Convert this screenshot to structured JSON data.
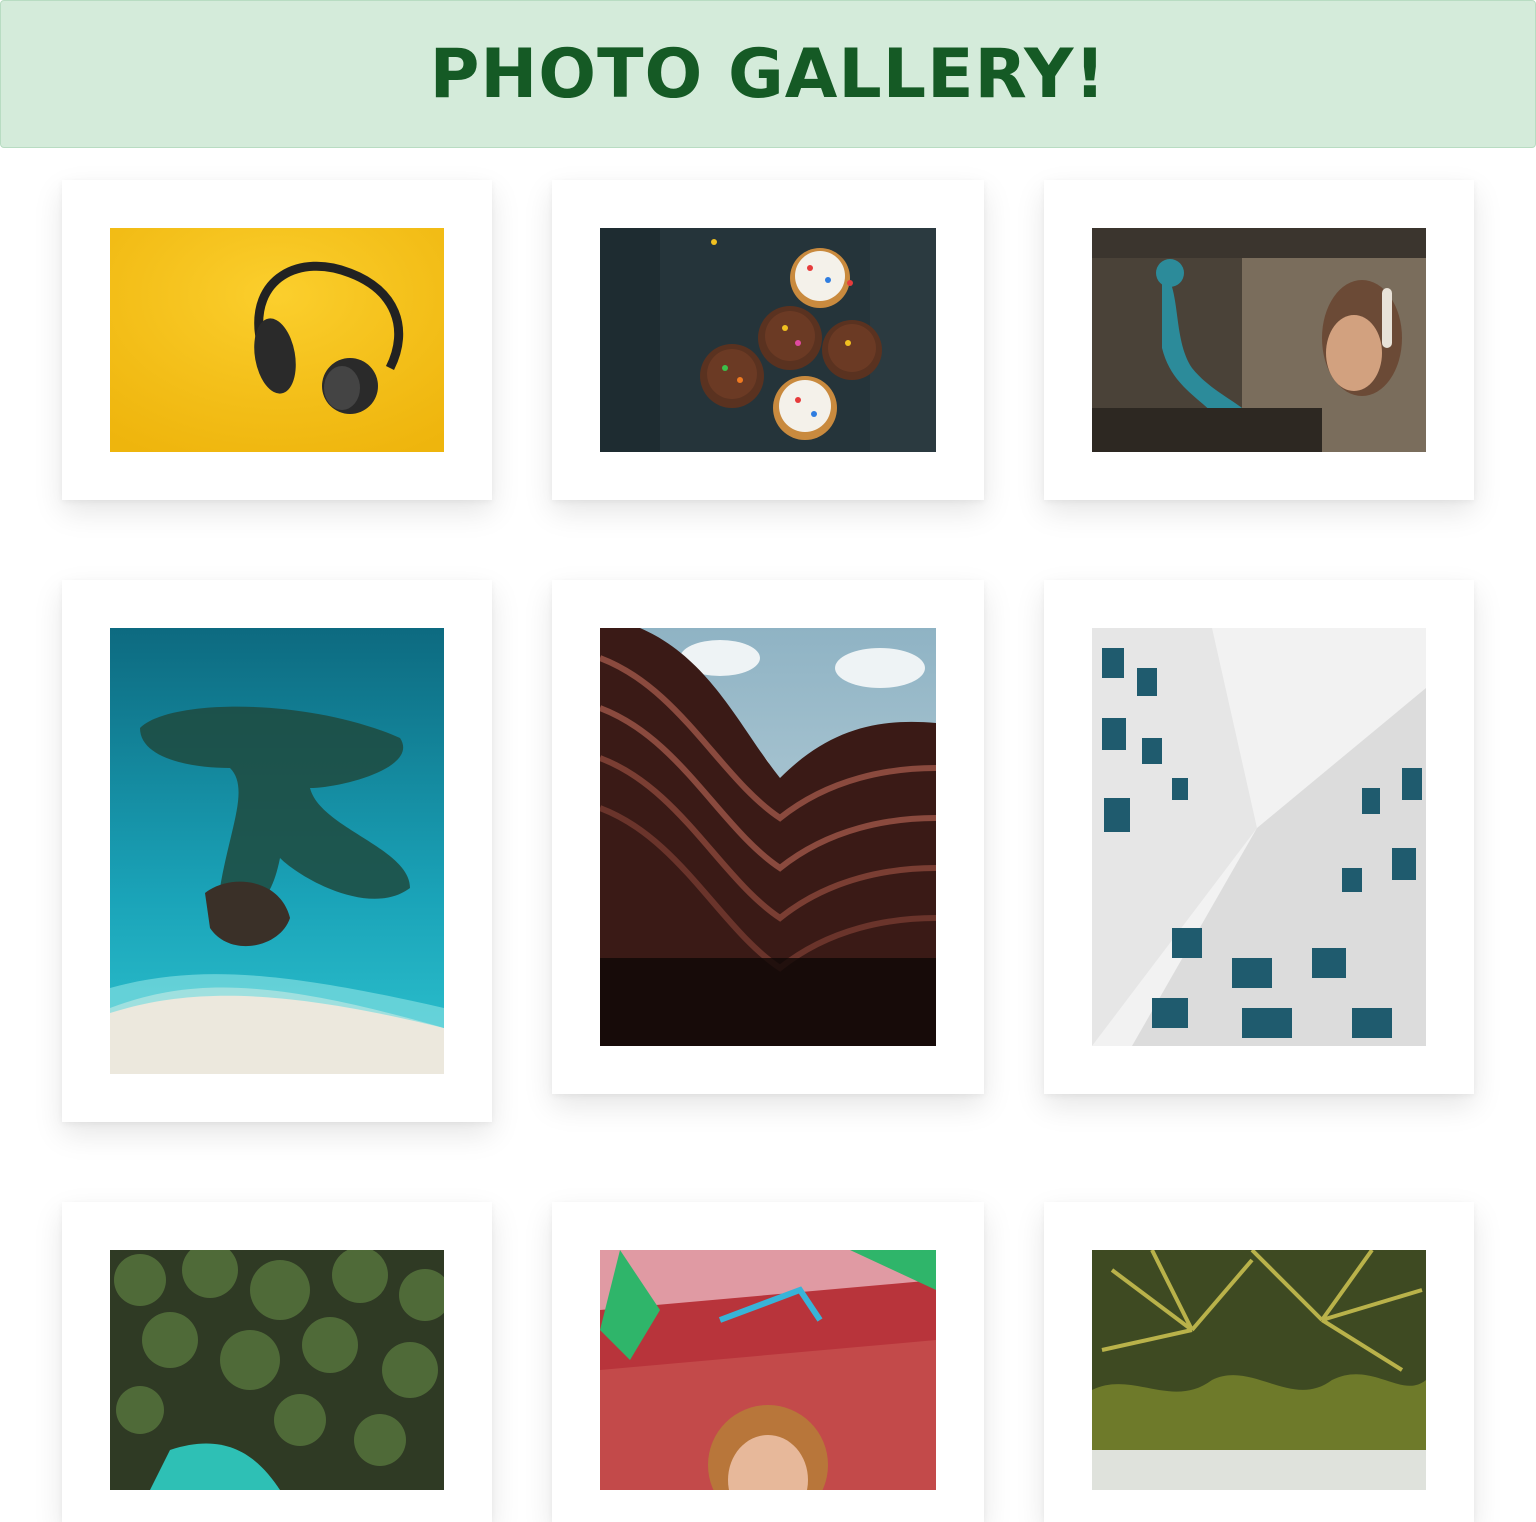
{
  "header": {
    "title": "PHOTO GALLERY!",
    "background": "#d4ebda",
    "title_color": "#155a25"
  },
  "gallery": {
    "photos": [
      {
        "subject": "yellow-headphones"
      },
      {
        "subject": "cupcakes"
      },
      {
        "subject": "graffiti-woman"
      },
      {
        "subject": "aerial-beach"
      },
      {
        "subject": "curved-building"
      },
      {
        "subject": "white-building"
      },
      {
        "subject": "palm-trees-aerial"
      },
      {
        "subject": "graffiti-child"
      },
      {
        "subject": "palm-canopy"
      }
    ]
  }
}
